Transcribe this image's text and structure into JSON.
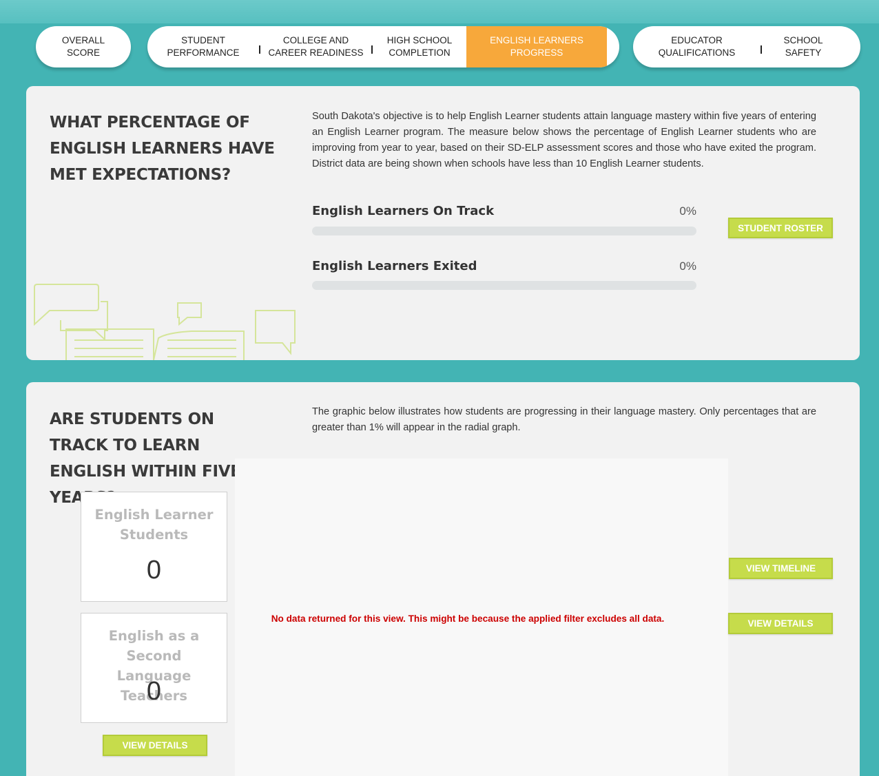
{
  "nav": {
    "tabs": [
      {
        "label": "OVERALL\nSCORE",
        "active": false
      },
      {
        "label": "STUDENT\nPERFORMANCE",
        "active": false
      },
      {
        "label": "COLLEGE AND\nCAREER READINESS",
        "active": false
      },
      {
        "label": "HIGH SCHOOL\nCOMPLETION",
        "active": false
      },
      {
        "label": "ENGLISH LEARNERS\nPROGRESS",
        "active": true
      },
      {
        "label": "EDUCATOR\nQUALIFICATIONS",
        "active": false
      },
      {
        "label": "SCHOOL\nSAFETY",
        "active": false
      }
    ],
    "active_color": "#f7a83b"
  },
  "section1": {
    "heading": "WHAT PERCENTAGE OF ENGLISH LEARNERS HAVE MET EXPECTATIONS?",
    "description": "South Dakota's objective is to help English Learner students attain language mastery within five years of entering an English Learner program. The measure below shows the percentage of English Learner students who are improving from year to year, based on their SD-ELP assessment scores and those who have exited the program. District data are being shown when schools have less than 10 English Learner students.",
    "metrics": [
      {
        "label": "English Learners On Track",
        "value": "0%",
        "percent": 0
      },
      {
        "label": "English Learners Exited",
        "value": "0%",
        "percent": 0
      }
    ],
    "roster_button": "STUDENT ROSTER",
    "illustration_icon": "open-book-speech-bubbles"
  },
  "section2": {
    "heading": "ARE STUDENTS ON TRACK TO LEARN ENGLISH WITHIN FIVE YEARS?",
    "description": "The graphic below illustrates how students are progressing in their language mastery.  Only percentages that are greater than 1% will appear in the radial graph.",
    "cards": [
      {
        "title": "English Learner\nStudents",
        "value": "0"
      },
      {
        "title": "English as a Second\nLanguage Teachers",
        "value": "0"
      }
    ],
    "cards_details_button": "VIEW DETAILS",
    "no_data_message": "No data returned for this view. This might be because the applied filter excludes all data.",
    "timeline_button": "VIEW TIMELINE",
    "details_button": "VIEW DETAILS"
  },
  "colors": {
    "background": "#43b4b4",
    "panel": "#f2f2f2",
    "button": "#c6dc4b",
    "error": "#cc0000"
  }
}
